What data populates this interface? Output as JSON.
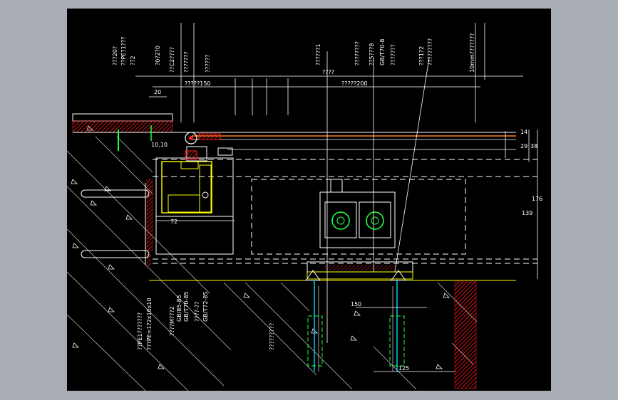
{
  "colors": {
    "background": "#000000",
    "frame": "#a8acb4",
    "line": "#ffffff",
    "hatch": "#ff2020",
    "accent_yellow": "#ffff00",
    "accent_orange": "#ff8020",
    "accent_green": "#20ff40",
    "accent_cyan": "#00e0ff"
  },
  "drawing": {
    "top_labels": [
      "???20?",
      "??PE?1???",
      "??2",
      "?0?2?0",
      "??C2????",
      "???????",
      "??????"
    ],
    "top_labels_b": [
      "??5???8",
      "GB/T70-8",
      "???????",
      "???1?2",
      "?????????"
    ],
    "dims": {
      "d20": "20",
      "d10_10": "10,10",
      "d72": "72",
      "d150": "150",
      "d125": "125",
      "d29": "29",
      "d14": "14",
      "d38": "38",
      "d176": "176",
      "d139": "139",
      "span150": "?????150",
      "span200": "?????200",
      "midtext": "????",
      "rightnote": "10mm???????"
    },
    "left_notes": [
      "??PE1???????",
      "???PE=1?2x10x10",
      "????M???2",
      "GB/85-85",
      "GB/T70-85",
      "????-??",
      "GB/T72-85"
    ],
    "bottom_note": "?????????",
    "vert_top1": "??????1",
    "vert_top2": "????????"
  }
}
